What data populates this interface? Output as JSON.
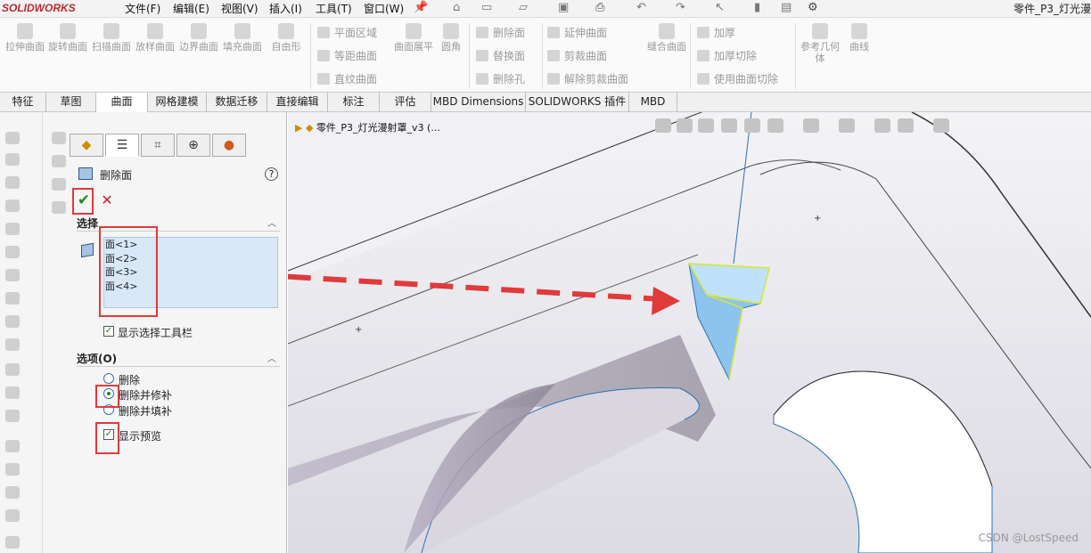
{
  "app": {
    "logo": "SOLIDWORKS",
    "window_title": "零件_P3_灯光漫"
  },
  "menus": [
    "文件(F)",
    "编辑(E)",
    "视图(V)",
    "插入(I)",
    "工具(T)",
    "窗口(W)"
  ],
  "ribbon": {
    "big_buttons": [
      "拉伸曲面",
      "旋转曲面",
      "扫描曲面",
      "放样曲面",
      "边界曲面",
      "填充曲面",
      "自由形"
    ],
    "col1": [
      "平面区域",
      "等距曲面",
      "直纹曲面"
    ],
    "extra_buttons": [
      "曲面展平",
      "圆角"
    ],
    "col2": [
      "删除面",
      "替换面",
      "删除孔"
    ],
    "col3": [
      "延伸曲面",
      "剪裁曲面",
      "解除剪裁曲面"
    ],
    "knit": "缝合曲面",
    "col4": [
      "加厚",
      "加厚切除",
      "使用曲面切除"
    ],
    "ref_geom": "参考几何体",
    "curves": "曲线"
  },
  "tabs": [
    "特征",
    "草图",
    "曲面",
    "网格建模",
    "数据迁移",
    "直接编辑",
    "标注",
    "评估",
    "MBD Dimensions",
    "SOLIDWORKS 插件",
    "MBD"
  ],
  "active_tab": "曲面",
  "panel": {
    "title": "删除面",
    "help": "?",
    "section_select": "选择",
    "faces": [
      "面<1>",
      "面<2>",
      "面<3>",
      "面<4>"
    ],
    "show_toolbar": "显示选择工具栏",
    "section_options": "选项(O)",
    "opt_delete": "删除",
    "opt_patch": "删除并修补",
    "opt_fill": "删除并填补",
    "show_preview": "显示预览",
    "selected_option": "删除并修补"
  },
  "viewport": {
    "breadcrumb": "零件_P3_灯光漫射罩_v3 (..."
  },
  "colors": {
    "highlight_red": "#e03a3a",
    "selection_blue": "#d8e8f7",
    "accent_ok": "#1e8e2e"
  },
  "watermark": "CSDN @LostSpeed"
}
